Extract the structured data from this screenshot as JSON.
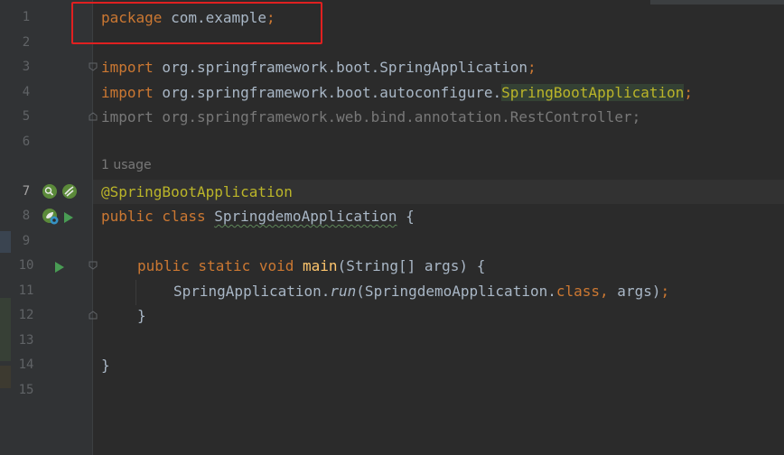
{
  "editor": {
    "line_numbers": [
      "1",
      "2",
      "3",
      "4",
      "5",
      "6",
      "7",
      "8",
      "9",
      "10",
      "11",
      "12",
      "13",
      "14",
      "15"
    ],
    "lines": {
      "l1_package": "package",
      "l1_name": " com.example",
      "l1_semicolon": ";",
      "l3_import": "import",
      "l3_path": " org.springframework.boot.SpringApplication",
      "l3_semi": ";",
      "l4_import": "import",
      "l4_path": " org.springframework.boot.autoconfigure.",
      "l4_class": "SpringBootApplication",
      "l4_semi": ";",
      "l5_text": "import org.springframework.web.bind.annotation.RestController;",
      "inlay_usage": "1 usage",
      "l7_annotation": "@SpringBootApplication",
      "l8_public": "public",
      "l8_class": " class ",
      "l8_name": "SpringdemoApplication",
      "l8_brace": " {",
      "l10_mods": "public static void ",
      "l10_main": "main",
      "l10_params": "(String[] args) {",
      "l11_call": "SpringApplication.",
      "l11_run": "run",
      "l11_args_open": "(SpringdemoApplication.",
      "l11_class_kw": "class",
      "l11_comma": ",",
      "l11_args_close": " args)",
      "l11_semi": ";",
      "l12_brace": "}",
      "l14_brace": "}"
    }
  },
  "colors": {
    "background": "#2b2b2b",
    "keyword": "#cc7832",
    "annotation": "#bbb529",
    "method": "#ffc66d",
    "text": "#a9b7c6",
    "unused": "#787878",
    "highlight_box": "#e02020"
  },
  "icons": {
    "line7": [
      "bean-find-usages-icon",
      "spring-bean-icon"
    ],
    "line8": [
      "spring-boot-run-config-icon",
      "run-icon"
    ],
    "line10": [
      "run-icon"
    ]
  }
}
